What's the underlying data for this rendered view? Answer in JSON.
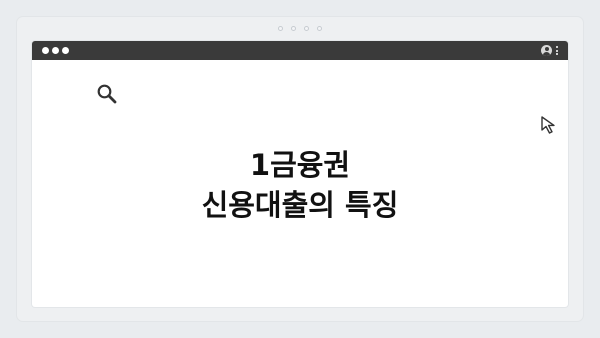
{
  "window": {
    "traffic_lights": [
      "close",
      "minimize",
      "maximize"
    ],
    "icons": [
      "profile-icon",
      "kebab-menu-icon",
      "search-icon",
      "cursor-icon",
      "face-icon"
    ]
  },
  "content": {
    "headline_line1": "1금융권",
    "headline_line2": "신용대출의 특징"
  },
  "colors": {
    "background": "#e9ecef",
    "titlebar": "#3a3a3a",
    "text": "#111111"
  }
}
